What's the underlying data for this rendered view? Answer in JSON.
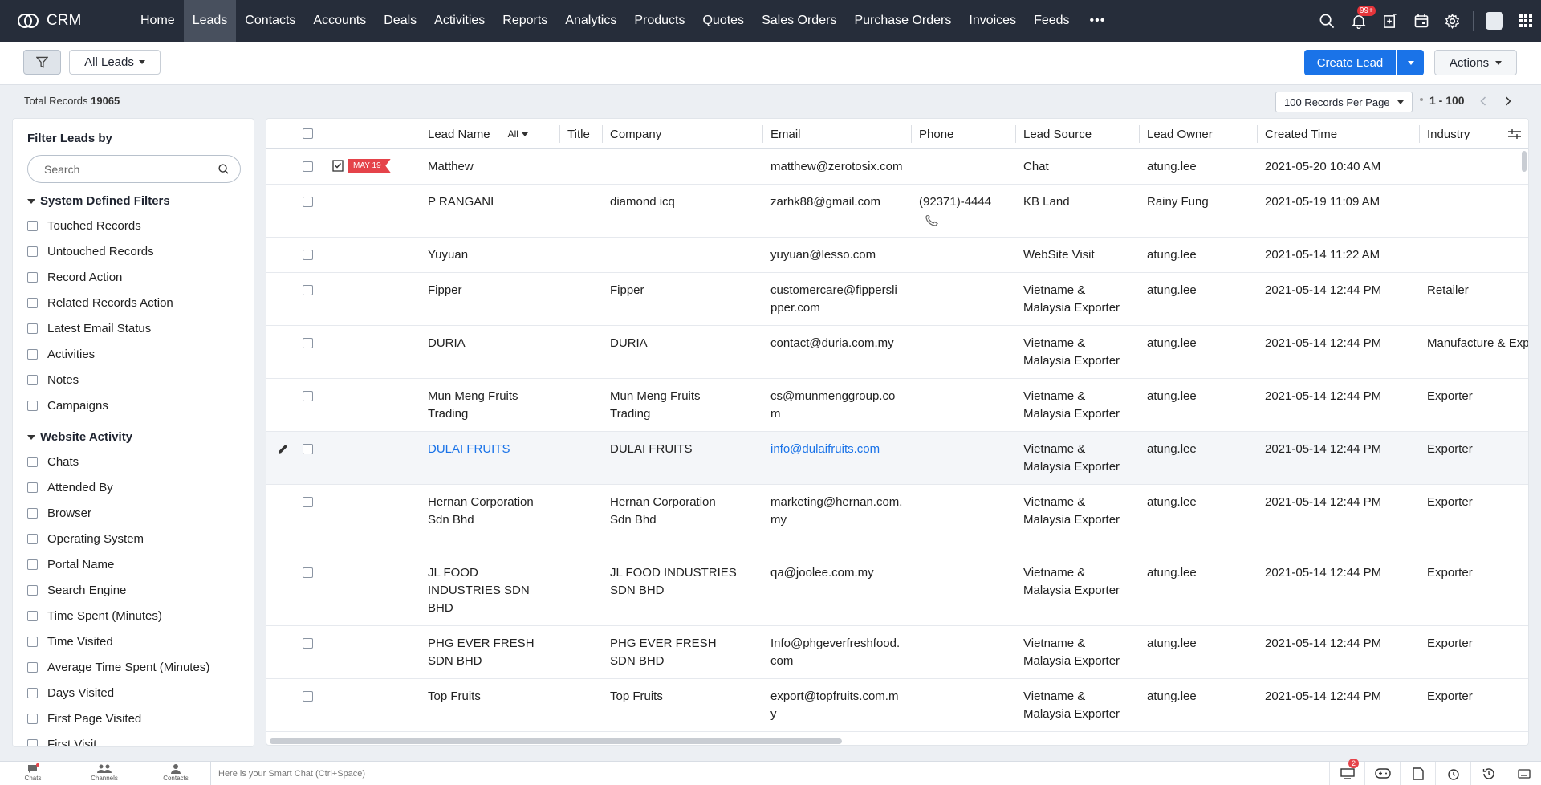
{
  "app": {
    "name": "CRM"
  },
  "nav": {
    "items": [
      "Home",
      "Leads",
      "Contacts",
      "Accounts",
      "Deals",
      "Activities",
      "Reports",
      "Analytics",
      "Products",
      "Quotes",
      "Sales Orders",
      "Purchase Orders",
      "Invoices",
      "Feeds"
    ],
    "active": "Leads",
    "more": "•••",
    "notification_badge": "99+"
  },
  "toolbar": {
    "view": "All Leads",
    "create_label": "Create Lead",
    "actions_label": "Actions"
  },
  "records": {
    "total_label": "Total Records",
    "total": "19065",
    "per_page": "100 Records Per Page",
    "range": "1 - 100"
  },
  "sidebar": {
    "title": "Filter Leads by",
    "search_placeholder": "Search",
    "section1": "System Defined Filters",
    "system_filters": [
      "Touched Records",
      "Untouched Records",
      "Record Action",
      "Related Records Action",
      "Latest Email Status",
      "Activities",
      "Notes",
      "Campaigns"
    ],
    "section2": "Website Activity",
    "website_filters": [
      "Chats",
      "Attended By",
      "Browser",
      "Operating System",
      "Portal Name",
      "Search Engine",
      "Time Spent (Minutes)",
      "Time Visited",
      "Average Time Spent (Minutes)",
      "Days Visited",
      "First Page Visited",
      "First Visit"
    ]
  },
  "table": {
    "columns": {
      "lead_name": "Lead Name",
      "all": "All",
      "title": "Title",
      "company": "Company",
      "email": "Email",
      "phone": "Phone",
      "lead_source": "Lead Source",
      "lead_owner": "Lead Owner",
      "created_time": "Created Time",
      "industry": "Industry"
    },
    "task_tag": "MAY 19",
    "rows": [
      {
        "name": "Matthew",
        "company": "",
        "email": "matthew@zerotosix.com",
        "phone": "",
        "source": "Chat",
        "owner": "atung.lee",
        "created": "2021-05-20 10:40 AM",
        "industry": ""
      },
      {
        "name": "P RANGANI",
        "company": "diamond icq",
        "email": "zarhk88@gmail.com",
        "phone": "(92371)-4444",
        "source": "KB Land",
        "owner": "Rainy Fung",
        "created": "2021-05-19 11:09 AM",
        "industry": ""
      },
      {
        "name": "Yuyuan",
        "company": "",
        "email": "yuyuan@lesso.com",
        "phone": "",
        "source": "WebSite Visit",
        "owner": "atung.lee",
        "created": "2021-05-14 11:22 AM",
        "industry": ""
      },
      {
        "name": "Fipper",
        "company": "Fipper",
        "email": "customercare@fipperslipper.com",
        "phone": "",
        "source": "Vietname & Malaysia Exporter",
        "owner": "atung.lee",
        "created": "2021-05-14 12:44 PM",
        "industry": "Retailer"
      },
      {
        "name": "DURIA",
        "company": "DURIA",
        "email": "contact@duria.com.my",
        "phone": "",
        "source": "Vietname & Malaysia Exporter",
        "owner": "atung.lee",
        "created": "2021-05-14 12:44 PM",
        "industry": "Manufacture & Exp"
      },
      {
        "name": "Mun Meng Fruits Trading",
        "company": "Mun Meng Fruits Trading",
        "email": "cs@munmenggroup.com",
        "phone": "",
        "source": "Vietname & Malaysia Exporter",
        "owner": "atung.lee",
        "created": "2021-05-14 12:44 PM",
        "industry": "Exporter"
      },
      {
        "name": "DULAI FRUITS",
        "company": "DULAI FRUITS",
        "email": "info@dulaifruits.com",
        "phone": "",
        "source": "Vietname & Malaysia Exporter",
        "owner": "atung.lee",
        "created": "2021-05-14 12:44 PM",
        "industry": "Exporter"
      },
      {
        "name": "Hernan Corporation Sdn Bhd",
        "company": "Hernan Corporation Sdn Bhd",
        "email": "marketing@hernan.com.my",
        "phone": "",
        "source": "Vietname & Malaysia Exporter",
        "owner": "atung.lee",
        "created": "2021-05-14 12:44 PM",
        "industry": "Exporter"
      },
      {
        "name": "JL FOOD INDUSTRIES SDN BHD",
        "company": "JL FOOD INDUSTRIES SDN BHD",
        "email": "qa@joolee.com.my",
        "phone": "",
        "source": "Vietname & Malaysia Exporter",
        "owner": "atung.lee",
        "created": "2021-05-14 12:44 PM",
        "industry": "Exporter"
      },
      {
        "name": "PHG EVER FRESH SDN BHD",
        "company": "PHG EVER FRESH SDN BHD",
        "email": "Info@phgeverfreshfood.com",
        "phone": "",
        "source": "Vietname & Malaysia Exporter",
        "owner": "atung.lee",
        "created": "2021-05-14 12:44 PM",
        "industry": "Exporter"
      },
      {
        "name": "Top Fruits",
        "company": "Top Fruits",
        "email": "export@topfruits.com.my",
        "phone": "",
        "source": "Vietname & Malaysia Exporter",
        "owner": "atung.lee",
        "created": "2021-05-14 12:44 PM",
        "industry": "Exporter"
      }
    ]
  },
  "bottombar": {
    "chats": "Chats",
    "channels": "Channels",
    "contacts": "Contacts",
    "smart_chat_placeholder": "Here is your Smart Chat (Ctrl+Space)",
    "badge": "2"
  },
  "colors": {
    "accent": "#1a73e8",
    "nav_bg": "#262d3a",
    "badge": "#e5434a"
  }
}
